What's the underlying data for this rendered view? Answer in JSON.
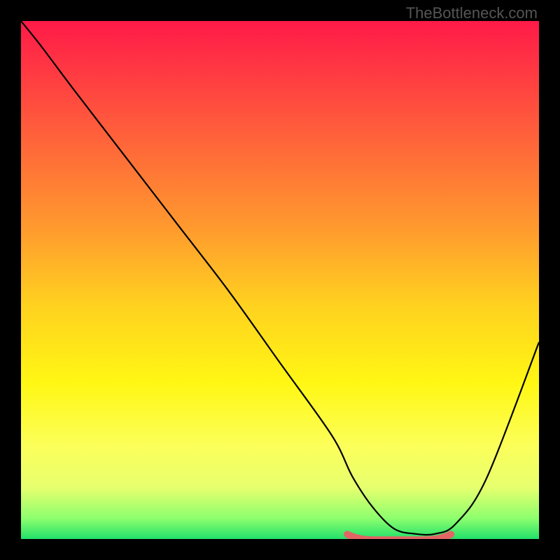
{
  "watermark": "TheBottleneck.com",
  "chart_data": {
    "type": "line",
    "title": "",
    "xlabel": "",
    "ylabel": "",
    "xlim": [
      0,
      100
    ],
    "ylim": [
      0,
      100
    ],
    "series": [
      {
        "name": "bottleneck-curve",
        "x": [
          0,
          4,
          10,
          20,
          30,
          40,
          50,
          60,
          64,
          68,
          72,
          76,
          80,
          84,
          90,
          100
        ],
        "values": [
          100,
          95,
          87,
          74,
          61,
          48,
          34,
          20,
          12,
          6,
          2,
          1,
          1,
          3,
          12,
          38
        ]
      }
    ],
    "highlight": {
      "name": "sweet-spot",
      "x_range": [
        63,
        83
      ],
      "y": 0.5
    },
    "gradient_stops": [
      {
        "offset": 0.0,
        "color": "#ff1a48"
      },
      {
        "offset": 0.2,
        "color": "#ff5a3c"
      },
      {
        "offset": 0.4,
        "color": "#ff9a2e"
      },
      {
        "offset": 0.55,
        "color": "#ffd21f"
      },
      {
        "offset": 0.7,
        "color": "#fff714"
      },
      {
        "offset": 0.82,
        "color": "#fcff5a"
      },
      {
        "offset": 0.9,
        "color": "#e7ff6e"
      },
      {
        "offset": 0.96,
        "color": "#8dff6e"
      },
      {
        "offset": 1.0,
        "color": "#22e06a"
      }
    ]
  }
}
